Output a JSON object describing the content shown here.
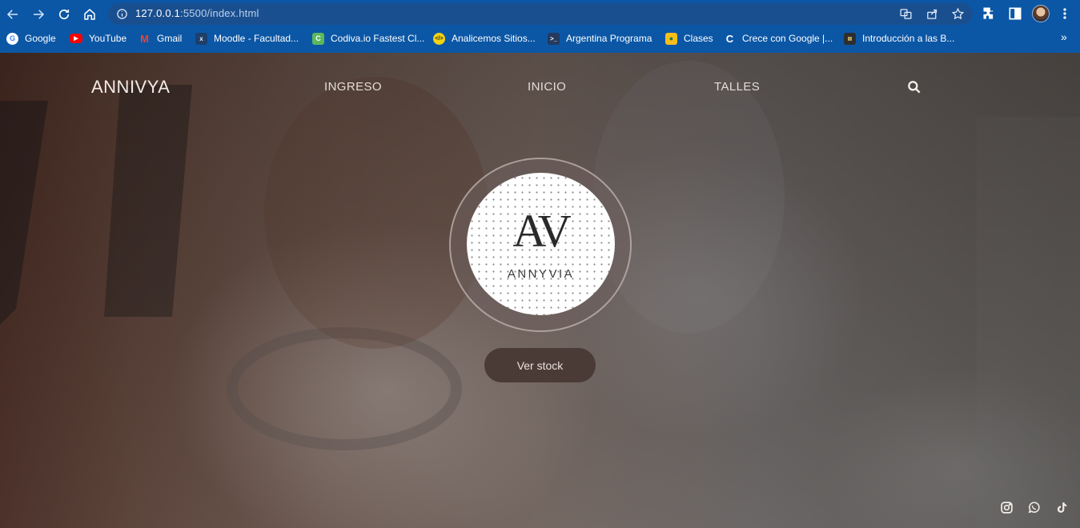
{
  "browser": {
    "url_host": "127.0.0.1",
    "url_rest": ":5500/index.html",
    "bookmarks": [
      {
        "label": "Google",
        "icon": "google-icon",
        "color": "#ffffff"
      },
      {
        "label": "YouTube",
        "icon": "youtube-icon",
        "color": "#ff0000"
      },
      {
        "label": "Gmail",
        "icon": "gmail-icon",
        "color": "#ffffff"
      },
      {
        "label": "Moodle - Facultad...",
        "icon": "moodle-icon",
        "color": "#2b5f8e"
      },
      {
        "label": "Codiva.io Fastest Cl...",
        "icon": "codiva-icon",
        "color": "#5cb85c"
      },
      {
        "label": "Analicemos Sitios...",
        "icon": "code-icon",
        "color": "#f2d30f"
      },
      {
        "label": "Argentina Programa",
        "icon": "terminal-icon",
        "color": "#243a5e"
      },
      {
        "label": "Clases",
        "icon": "classroom-icon",
        "color": "#f7bd1b"
      },
      {
        "label": "Crece con Google |...",
        "icon": "crece-icon",
        "color": "#1a73e8"
      },
      {
        "label": "Introducción a las B...",
        "icon": "intro-icon",
        "color": "#2e2e2e"
      }
    ]
  },
  "site": {
    "brand": "ANNIVYA",
    "nav": [
      "INGRESO",
      "INICIO",
      "TALLES"
    ],
    "logo_mark": "AV",
    "logo_word": "ANNYVIA",
    "cta": "Ver stock",
    "social": [
      "instagram-icon",
      "whatsapp-icon",
      "tiktok-icon"
    ]
  }
}
